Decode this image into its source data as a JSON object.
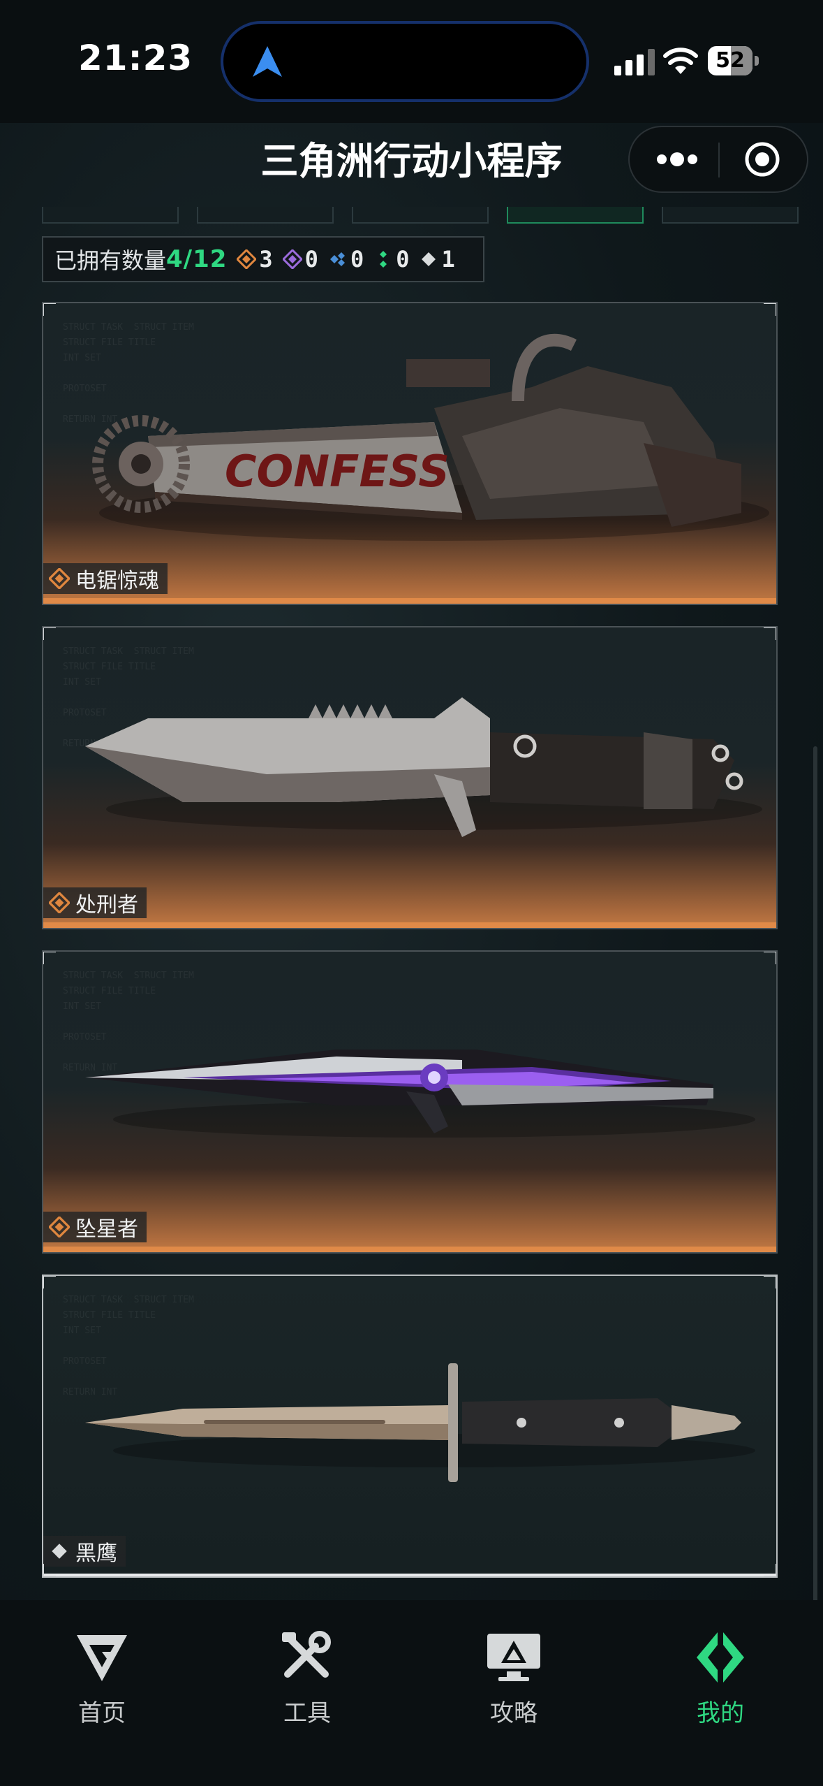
{
  "status_bar": {
    "time": "21:23",
    "battery": "52",
    "battery_level": 0.52
  },
  "header": {
    "title": "三角洲行动小程序"
  },
  "collection": {
    "owned_label": "已拥有数量",
    "owned_value": "4/12",
    "grades": [
      {
        "icon": "orange-diamond-icon",
        "color": "#e0873f",
        "count": "3"
      },
      {
        "icon": "purple-diamond-icon",
        "color": "#9b6bdc",
        "count": "0"
      },
      {
        "icon": "blue-diamond-icon",
        "color": "#4a8fd8",
        "count": "0"
      },
      {
        "icon": "green-diamond-icon",
        "color": "#2fd882",
        "count": "0"
      },
      {
        "icon": "white-diamond-icon",
        "color": "#d9dcdd",
        "count": "1"
      }
    ]
  },
  "items": [
    {
      "name": "电锯惊魂",
      "grade_color": "#e0873f",
      "art_text": "CONFESS"
    },
    {
      "name": "处刑者",
      "grade_color": "#e0873f",
      "art_text": ""
    },
    {
      "name": "坠星者",
      "grade_color": "#e0873f",
      "art_text": ""
    },
    {
      "name": "黑鹰",
      "grade_color": "#d9dcdd",
      "art_text": ""
    }
  ],
  "tab_bar": {
    "items": [
      {
        "label": "首页",
        "icon": "home-logo-icon"
      },
      {
        "label": "工具",
        "icon": "tools-icon"
      },
      {
        "label": "攻略",
        "icon": "guide-icon"
      },
      {
        "label": "我的",
        "icon": "profile-logo-icon",
        "active": true
      }
    ]
  },
  "colors": {
    "accent": "#2fd882",
    "card_accent": "#e08a48",
    "island_border": "#15306b"
  }
}
